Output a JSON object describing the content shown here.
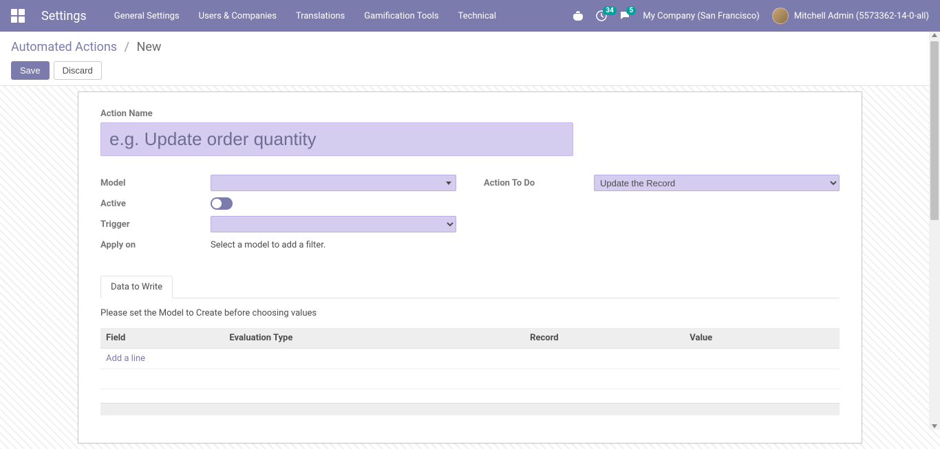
{
  "navbar": {
    "title": "Settings",
    "menu": [
      "General Settings",
      "Users & Companies",
      "Translations",
      "Gamification Tools",
      "Technical"
    ],
    "badges": {
      "activities": "34",
      "messages": "5"
    },
    "company": "My Company (San Francisco)",
    "user": "Mitchell Admin (5573362-14-0-all)"
  },
  "breadcrumb": {
    "root": "Automated Actions",
    "current": "New"
  },
  "buttons": {
    "save": "Save",
    "discard": "Discard"
  },
  "form": {
    "action_name_label": "Action Name",
    "action_name_placeholder": "e.g. Update order quantity",
    "model_label": "Model",
    "active_label": "Active",
    "trigger_label": "Trigger",
    "apply_on_label": "Apply on",
    "apply_on_value": "Select a model to add a filter.",
    "action_to_do_label": "Action To Do",
    "action_to_do_value": "Update the Record"
  },
  "tabs": {
    "data_to_write": "Data to Write"
  },
  "tab_content": {
    "hint": "Please set the Model to Create before choosing values",
    "columns": {
      "field": "Field",
      "eval_type": "Evaluation Type",
      "record": "Record",
      "value": "Value"
    },
    "add_line": "Add a line"
  }
}
